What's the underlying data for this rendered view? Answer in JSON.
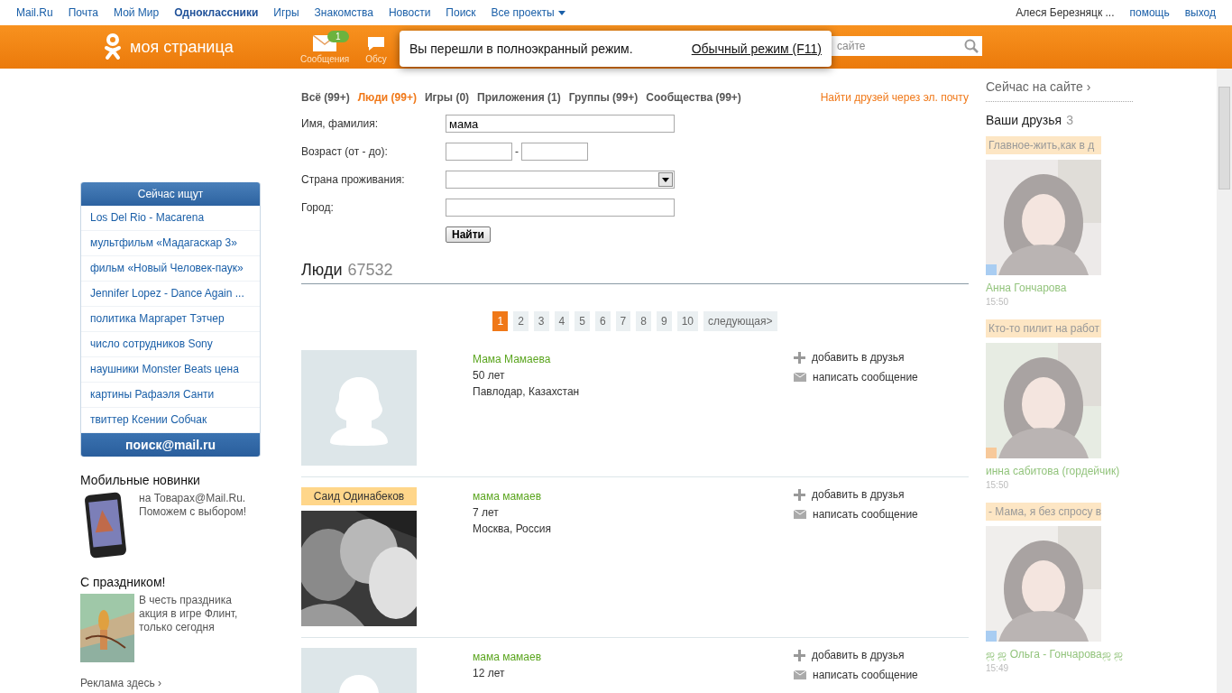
{
  "top_nav": {
    "items": [
      {
        "label": "Mail.Ru",
        "selected": false
      },
      {
        "label": "Почта",
        "selected": false
      },
      {
        "label": "Мой Мир",
        "selected": false
      },
      {
        "label": "Одноклассники",
        "selected": true
      },
      {
        "label": "Игры",
        "selected": false
      },
      {
        "label": "Знакомства",
        "selected": false
      },
      {
        "label": "Новости",
        "selected": false
      },
      {
        "label": "Поиск",
        "selected": false
      },
      {
        "label": "Все проекты",
        "selected": false
      }
    ],
    "user": "Алеся Березняцк ...",
    "links": [
      "помощь",
      "выход"
    ]
  },
  "header": {
    "title": "моя страница",
    "messages_label": "Сообщения",
    "messages_badge": "1",
    "discussions_label": "Обсу",
    "search_placeholder": "сайте"
  },
  "fullscreen_notice": {
    "text": "Вы перешли в полноэкранный режим.",
    "link": "Обычный режим (F11)"
  },
  "now_searching": {
    "title": "Сейчас ищут",
    "items": [
      "Los Del Rio - Macarena",
      "мультфильм «Мадагаскар 3»",
      "фильм «Новый Человек-паук»",
      "Jennifer Lopez - Dance Again ...",
      "политика Маргарет Тэтчер",
      "число сотрудников Sony",
      "наушники Monster Beats цена",
      "картины Рафаэля Санти",
      "твиттер Ксении Собчак"
    ],
    "footer": "поиск@mail.ru"
  },
  "promos": [
    {
      "title": "Мобильные новинки",
      "text": "на Товарах@Mail.Ru. Поможем с выбором!",
      "kind": "phone"
    },
    {
      "title": "С праздником!",
      "text": "В честь праздника акция в игре Флинт, только сегодня",
      "kind": "picture"
    }
  ],
  "ad_link": "Реклама здесь ›",
  "filter_tabs": [
    {
      "label": "Всё (99+)",
      "selected": false
    },
    {
      "label": "Люди (99+)",
      "selected": true
    },
    {
      "label": "Игры (0)",
      "selected": false
    },
    {
      "label": "Приложения (1)",
      "selected": false
    },
    {
      "label": "Группы (99+)",
      "selected": false
    },
    {
      "label": "Сообщества (99+)",
      "selected": false
    }
  ],
  "find_by_email": "Найти друзей через эл. почту",
  "form": {
    "name_label": "Имя, фамилия:",
    "name_value": "мама",
    "age_label": "Возраст (от - до):",
    "age_separator": "-",
    "country_label": "Страна проживания:",
    "city_label": "Город:",
    "submit": "Найти"
  },
  "results": {
    "title": "Люди",
    "count": "67532"
  },
  "pagination": {
    "pages": [
      {
        "label": "1",
        "selected": true
      },
      {
        "label": "2",
        "selected": false
      },
      {
        "label": "3",
        "selected": false
      },
      {
        "label": "4",
        "selected": false
      },
      {
        "label": "5",
        "selected": false
      },
      {
        "label": "6",
        "selected": false
      },
      {
        "label": "7",
        "selected": false
      },
      {
        "label": "8",
        "selected": false
      },
      {
        "label": "9",
        "selected": false
      },
      {
        "label": "10",
        "selected": false
      }
    ],
    "next": "следующая>"
  },
  "people": [
    {
      "kind": "placeholder",
      "name": "Мама Мамаева",
      "age": "50 лет",
      "location": "Павлодар, Казахстан",
      "add": "добавить в друзья",
      "message": "написать сообщение"
    },
    {
      "caption": "Саид Одинабеков",
      "name": "мама мамаев",
      "age": "7 лет",
      "location": "Москва, Россия",
      "add": "добавить в друзья",
      "message": "написать сообщение"
    },
    {
      "kind": "placeholder",
      "name": "мама мамаев",
      "age": "12 лет",
      "add": "добавить в друзья",
      "message": "написать сообщение"
    }
  ],
  "right": {
    "online_link": "Сейчас на сайте ›",
    "friends_title": "Ваши друзья",
    "friends_count": "3",
    "friends": [
      {
        "status": "Главное-жить,как в д",
        "name": "Анна Гончарова",
        "time": "15:50",
        "color": "#a9cdf2"
      },
      {
        "status": "Кто-то пилит на работ",
        "name": "инна сабитова (гордейчик)",
        "time": "15:50",
        "color": "#f7c99a"
      },
      {
        "status": "- Мама, я без спросу в",
        "name": "ஜ ஜ Ольга - Гончароваஜ ஜ",
        "time": "15:49",
        "color": "#a9cdf2"
      }
    ]
  }
}
